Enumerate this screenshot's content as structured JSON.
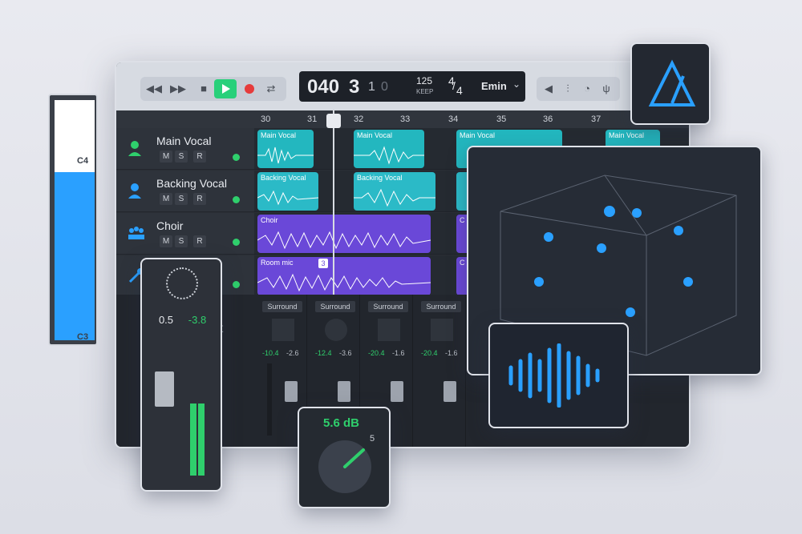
{
  "transport": {
    "rewind_icon": "rewind-icon",
    "ffwd_icon": "fast-forward-icon",
    "stop_icon": "stop-icon",
    "play_icon": "play-icon",
    "record_icon": "record-icon",
    "cycle_icon": "cycle-icon"
  },
  "lcd": {
    "bar": "040",
    "beat": "3",
    "div": "1",
    "tick": "0",
    "tempo": "125",
    "tempo_mode": "KEEP",
    "sig_num": "4",
    "sig_den": "4",
    "key": "Emin"
  },
  "ruler": [
    "30",
    "31",
    "32",
    "33",
    "34",
    "35",
    "36",
    "37"
  ],
  "tracks": [
    {
      "name": "Main Vocal",
      "m": "M",
      "s": "S",
      "r": "R",
      "icon": "singer-icon"
    },
    {
      "name": "Backing Vocal",
      "m": "M",
      "s": "S",
      "r": "R",
      "icon": "singer-icon"
    },
    {
      "name": "Choir",
      "m": "M",
      "s": "S",
      "r": "R",
      "icon": "choir-icon"
    },
    {
      "name": "",
      "m": "",
      "s": "",
      "r": "",
      "icon": "microphone-icon"
    }
  ],
  "clips": {
    "main1": "Main Vocal",
    "main2": "Main Vocal",
    "main3": "Main Vocal",
    "main4": "Main Vocal",
    "back1": "Backing Vocal",
    "back2": "Backing Vocal",
    "choir1": "Choir",
    "room1": "Room mic",
    "room_badge": "3",
    "c_short1": "C",
    "c_short2": "C"
  },
  "mixer": {
    "strips": [
      {
        "label": "Surround",
        "v1": "-10.4",
        "v2": "-2.6"
      },
      {
        "label": "Surround",
        "v1": "-12.4",
        "v2": "-3.6"
      },
      {
        "label": "Surround",
        "v1": "-20.4",
        "v2": "-1.6"
      },
      {
        "label": "Surround",
        "v1": "-20.4",
        "v2": "-1.6"
      }
    ],
    "partial_text": "ut"
  },
  "piano": {
    "c4": "C4",
    "c3": "C3"
  },
  "strip_panel": {
    "pan": "0.5",
    "gain": "-3.8"
  },
  "knob": {
    "value": "5.6 dB",
    "max_label": "5",
    "level": 0.8
  },
  "colors": {
    "accent_green": "#2fcf6c",
    "teal": "#23b7bf",
    "purple": "#6a48d8",
    "blue": "#2aa0ff"
  }
}
